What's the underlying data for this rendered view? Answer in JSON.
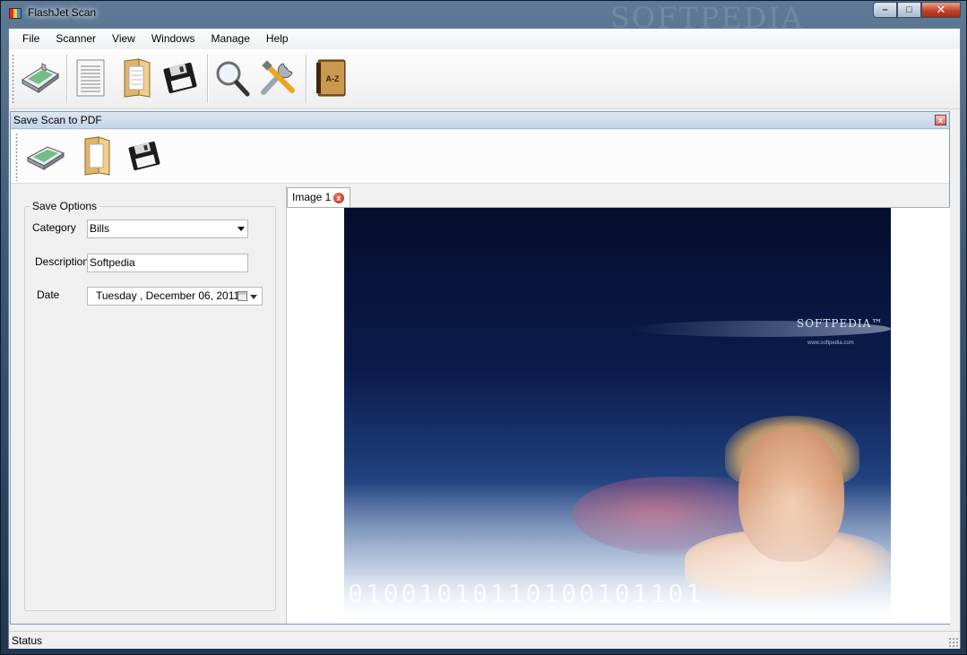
{
  "window": {
    "title": "FlashJet Scan",
    "watermark": "SOFTPEDIA",
    "controls": {
      "minimize": "–",
      "maximize": "□",
      "close": "✕"
    }
  },
  "menu": {
    "items": [
      {
        "label": "File"
      },
      {
        "label": "Scanner"
      },
      {
        "label": "View"
      },
      {
        "label": "Windows"
      },
      {
        "label": "Manage"
      },
      {
        "label": "Help"
      }
    ]
  },
  "toolbar": {
    "buttons": [
      {
        "icon": "scanner-icon"
      },
      {
        "icon": "document-icon"
      },
      {
        "icon": "folder-icon"
      },
      {
        "icon": "save-disk-icon"
      },
      {
        "icon": "magnifier-icon"
      },
      {
        "icon": "tools-icon"
      },
      {
        "icon": "address-book-icon",
        "text": "A-Z"
      }
    ]
  },
  "child_window": {
    "title": "Save Scan to PDF",
    "close_glyph": "x",
    "toolbar": [
      {
        "icon": "scanner-icon"
      },
      {
        "icon": "folder-icon"
      },
      {
        "icon": "save-disk-icon"
      }
    ],
    "save_options": {
      "legend": "Save Options",
      "category_label": "Category",
      "category_value": "Bills",
      "description_label": "Description",
      "description_value": "Softpedia",
      "date_label": "Date",
      "date_day": "Tuesday",
      "date_rest": ", December 06, 2011"
    },
    "tabs": [
      {
        "label": "Image 1",
        "close_glyph": "x"
      }
    ],
    "image": {
      "brand": "SOFTPEDIA™",
      "url": "www.softpedia.com",
      "binary": "01001010110100101101"
    }
  },
  "status": {
    "text": "Status"
  },
  "colors": {
    "frame": "#3c5876",
    "client_bg": "#f0f0f0",
    "child_title": "#c4d5e8",
    "image_dark": "#040d2c",
    "close_red": "#c3442b"
  }
}
